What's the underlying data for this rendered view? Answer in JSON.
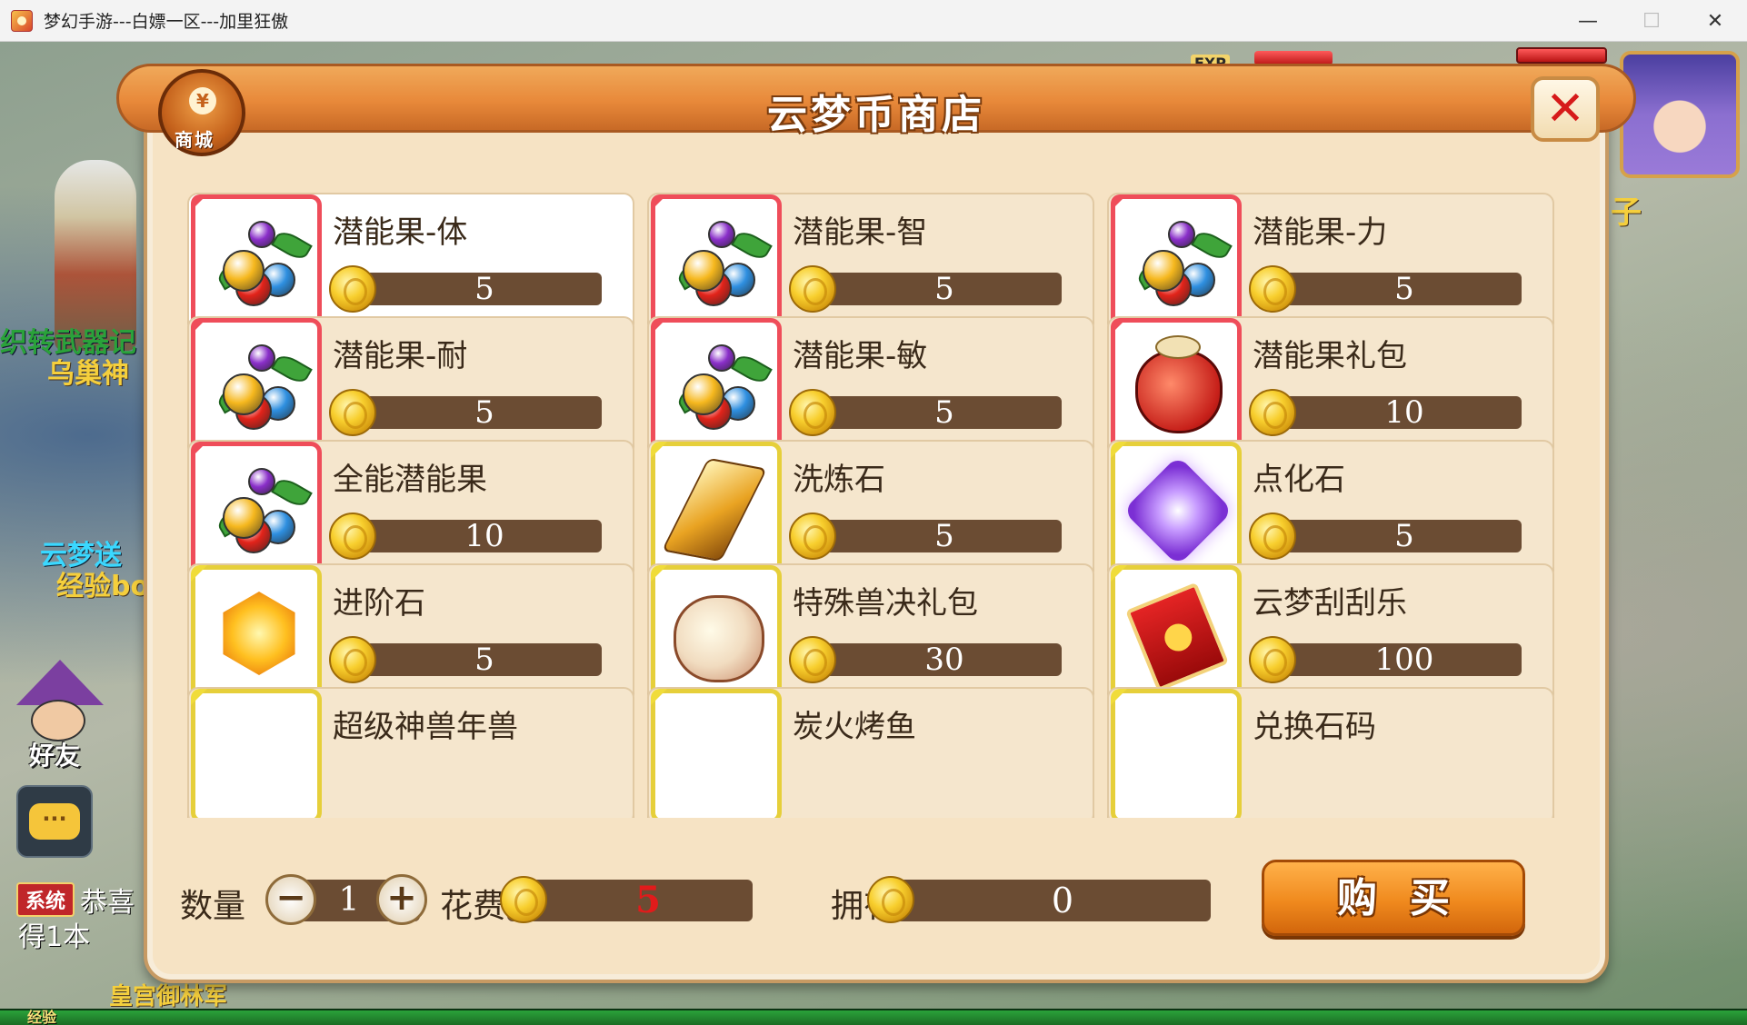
{
  "window": {
    "title": "梦幻手游---白嫖一区---加里狂傲",
    "minimize": "—",
    "maximize": "☐",
    "close": "✕"
  },
  "hud": {
    "left_texts": [
      "织转武器记",
      "乌巢神",
      "云梦送",
      "经验bo"
    ],
    "friend_label": "好友",
    "chat_label": "···",
    "system_badge": "系统",
    "system_text1": "恭喜",
    "system_text2": "得1本",
    "bottom_text": "皇宫御林军",
    "exp_label": "经验",
    "exp_top": "EXP",
    "right_text": "子"
  },
  "shop": {
    "title": "云梦币商店",
    "badge_label": "商城",
    "badge_symbol": "¥",
    "close_label": "✕",
    "items": [
      {
        "name": "潜能果-体",
        "price": "5",
        "icon": "potential-fruit-icon",
        "frame": "red",
        "selected": true
      },
      {
        "name": "潜能果-智",
        "price": "5",
        "icon": "potential-fruit-icon",
        "frame": "red",
        "selected": false
      },
      {
        "name": "潜能果-力",
        "price": "5",
        "icon": "potential-fruit-icon",
        "frame": "red",
        "selected": false
      },
      {
        "name": "潜能果-耐",
        "price": "5",
        "icon": "potential-fruit-icon",
        "frame": "red",
        "selected": false
      },
      {
        "name": "潜能果-敏",
        "price": "5",
        "icon": "potential-fruit-icon",
        "frame": "red",
        "selected": false
      },
      {
        "name": "潜能果礼包",
        "price": "10",
        "icon": "gift-bag-icon",
        "frame": "red",
        "selected": false
      },
      {
        "name": "全能潜能果",
        "price": "10",
        "icon": "potential-fruit-icon",
        "frame": "red",
        "selected": false
      },
      {
        "name": "洗炼石",
        "price": "5",
        "icon": "refining-stone-icon",
        "frame": "gold",
        "selected": false
      },
      {
        "name": "点化石",
        "price": "5",
        "icon": "purple-gem-icon",
        "frame": "gold",
        "selected": false
      },
      {
        "name": "进阶石",
        "price": "5",
        "icon": "orange-gem-icon",
        "frame": "gold",
        "selected": false
      },
      {
        "name": "特殊兽决礼包",
        "price": "30",
        "icon": "beast-gift-bag-icon",
        "frame": "gold",
        "selected": false
      },
      {
        "name": "云梦刮刮乐",
        "price": "100",
        "icon": "scratch-ticket-icon",
        "frame": "gold",
        "selected": false
      }
    ],
    "partial_row_names": [
      "超级神兽年兽",
      "炭火烤鱼",
      "兑换石码"
    ],
    "footer": {
      "qty_label": "数量",
      "qty_value": "1",
      "minus": "−",
      "plus": "+",
      "cost_label": "花费",
      "cost_value": "5",
      "own_label": "拥有",
      "own_value": "0",
      "buy_label": "购买"
    }
  },
  "colors": {
    "accent_orange": "#e8893a",
    "red_frame": "#ef4d5a",
    "gold_frame": "#e6cf3a",
    "price_pill": "#6b4c33",
    "cost_red": "#e11b1b"
  }
}
